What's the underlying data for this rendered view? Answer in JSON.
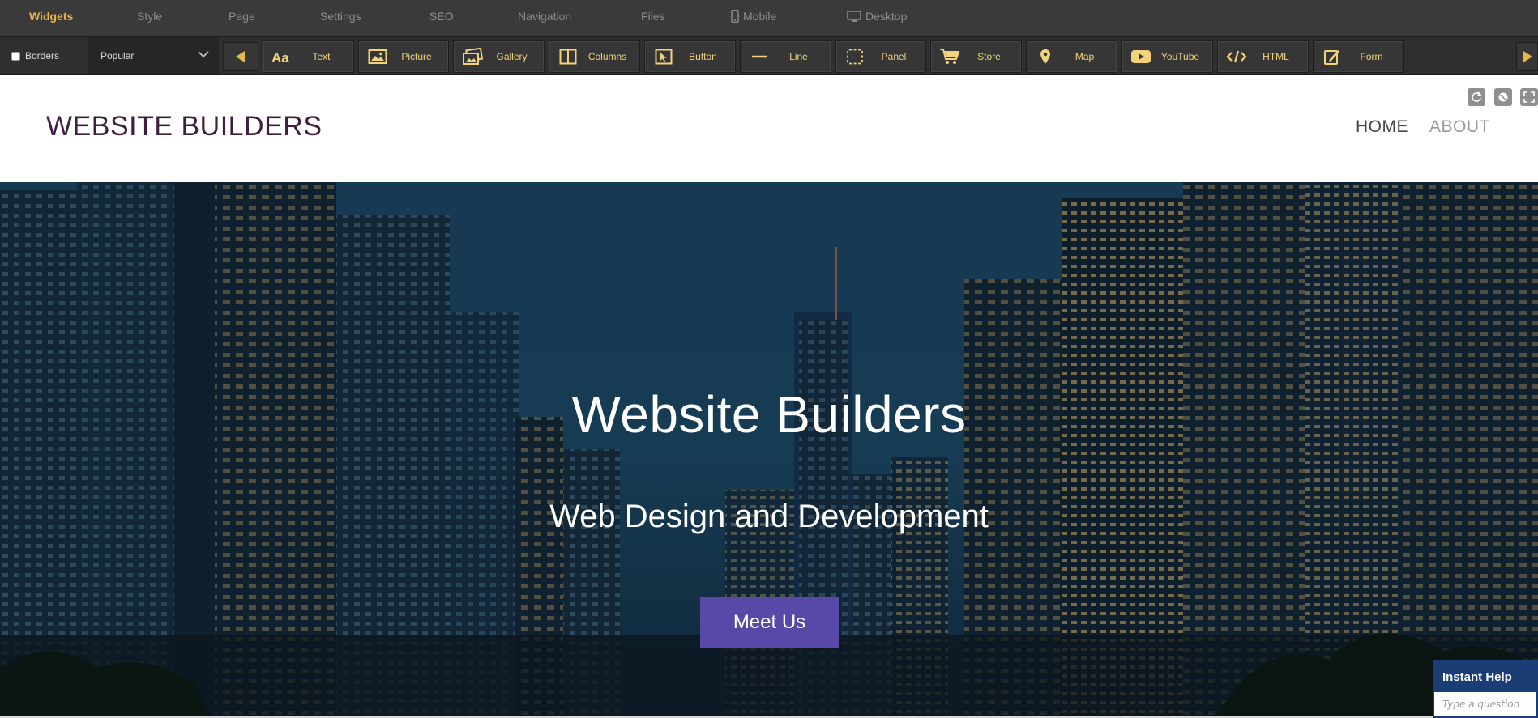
{
  "topmenu": {
    "items": [
      {
        "label": "Widgets",
        "active": true
      },
      {
        "label": "Style"
      },
      {
        "label": "Page"
      },
      {
        "label": "Settings"
      },
      {
        "label": "SEO"
      },
      {
        "label": "Navigation"
      },
      {
        "label": "Files"
      },
      {
        "label": "Mobile",
        "icon": "mobile-icon"
      },
      {
        "label": "Desktop",
        "icon": "desktop-icon"
      }
    ]
  },
  "toolbar": {
    "borders_label": "Borders",
    "category": "Popular",
    "widgets": [
      {
        "label": "Text",
        "icon": "text-icon"
      },
      {
        "label": "Picture",
        "icon": "picture-icon"
      },
      {
        "label": "Gallery",
        "icon": "gallery-icon"
      },
      {
        "label": "Columns",
        "icon": "columns-icon"
      },
      {
        "label": "Button",
        "icon": "button-icon"
      },
      {
        "label": "Line",
        "icon": "line-icon"
      },
      {
        "label": "Panel",
        "icon": "panel-icon"
      },
      {
        "label": "Store",
        "icon": "cart-icon"
      },
      {
        "label": "Map",
        "icon": "map-pin-icon"
      },
      {
        "label": "YouTube",
        "icon": "youtube-icon"
      },
      {
        "label": "HTML",
        "icon": "code-icon"
      },
      {
        "label": "Form",
        "icon": "form-icon"
      }
    ]
  },
  "site": {
    "logo": "WEBSITE BUILDERS",
    "nav": [
      "HOME",
      "ABOUT"
    ],
    "hero": {
      "title": "Website Builders",
      "subtitle": "Web Design and Development",
      "button": "Meet Us"
    }
  },
  "help": {
    "title": "Instant Help",
    "placeholder": "Type a question"
  },
  "colors": {
    "accent": "#e9b84a",
    "widget_text": "#f2d37a",
    "logo": "#3f1e3f",
    "cta": "#5849a8",
    "help": "#1a3d75"
  }
}
